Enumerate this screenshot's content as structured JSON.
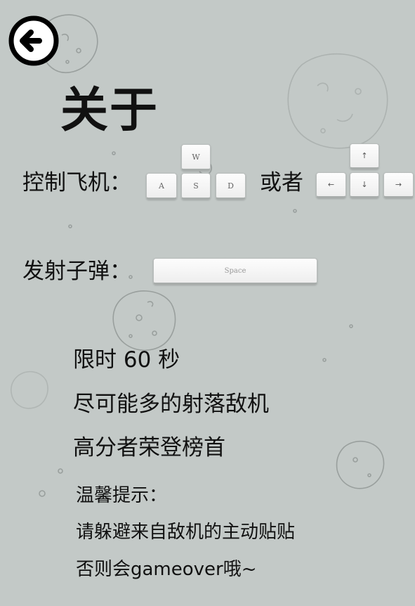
{
  "page": {
    "title": "关于",
    "back_icon": "arrow-left-circle-icon",
    "background_decor": "asteroid-sketch"
  },
  "controls": {
    "move_label": "控制飞机：",
    "or_label": "或者",
    "wasd_keys": {
      "w": "W",
      "a": "A",
      "s": "S",
      "d": "D"
    },
    "arrow_keys": {
      "up": "↑",
      "left": "←",
      "down": "↓",
      "right": "→"
    },
    "fire_label": "发射子弹：",
    "space_key": "Space"
  },
  "rules": [
    "限时 60 秒",
    "尽可能多的射落敌机",
    "高分者荣登榜首"
  ],
  "tips": {
    "title": "温馨提示：",
    "lines": [
      "请躲避来自敌机的主动贴贴",
      "否则会gameover哦~"
    ]
  },
  "colors": {
    "background": "#c3c9c7",
    "text": "#111111",
    "key_face": "#f7f7f7"
  }
}
